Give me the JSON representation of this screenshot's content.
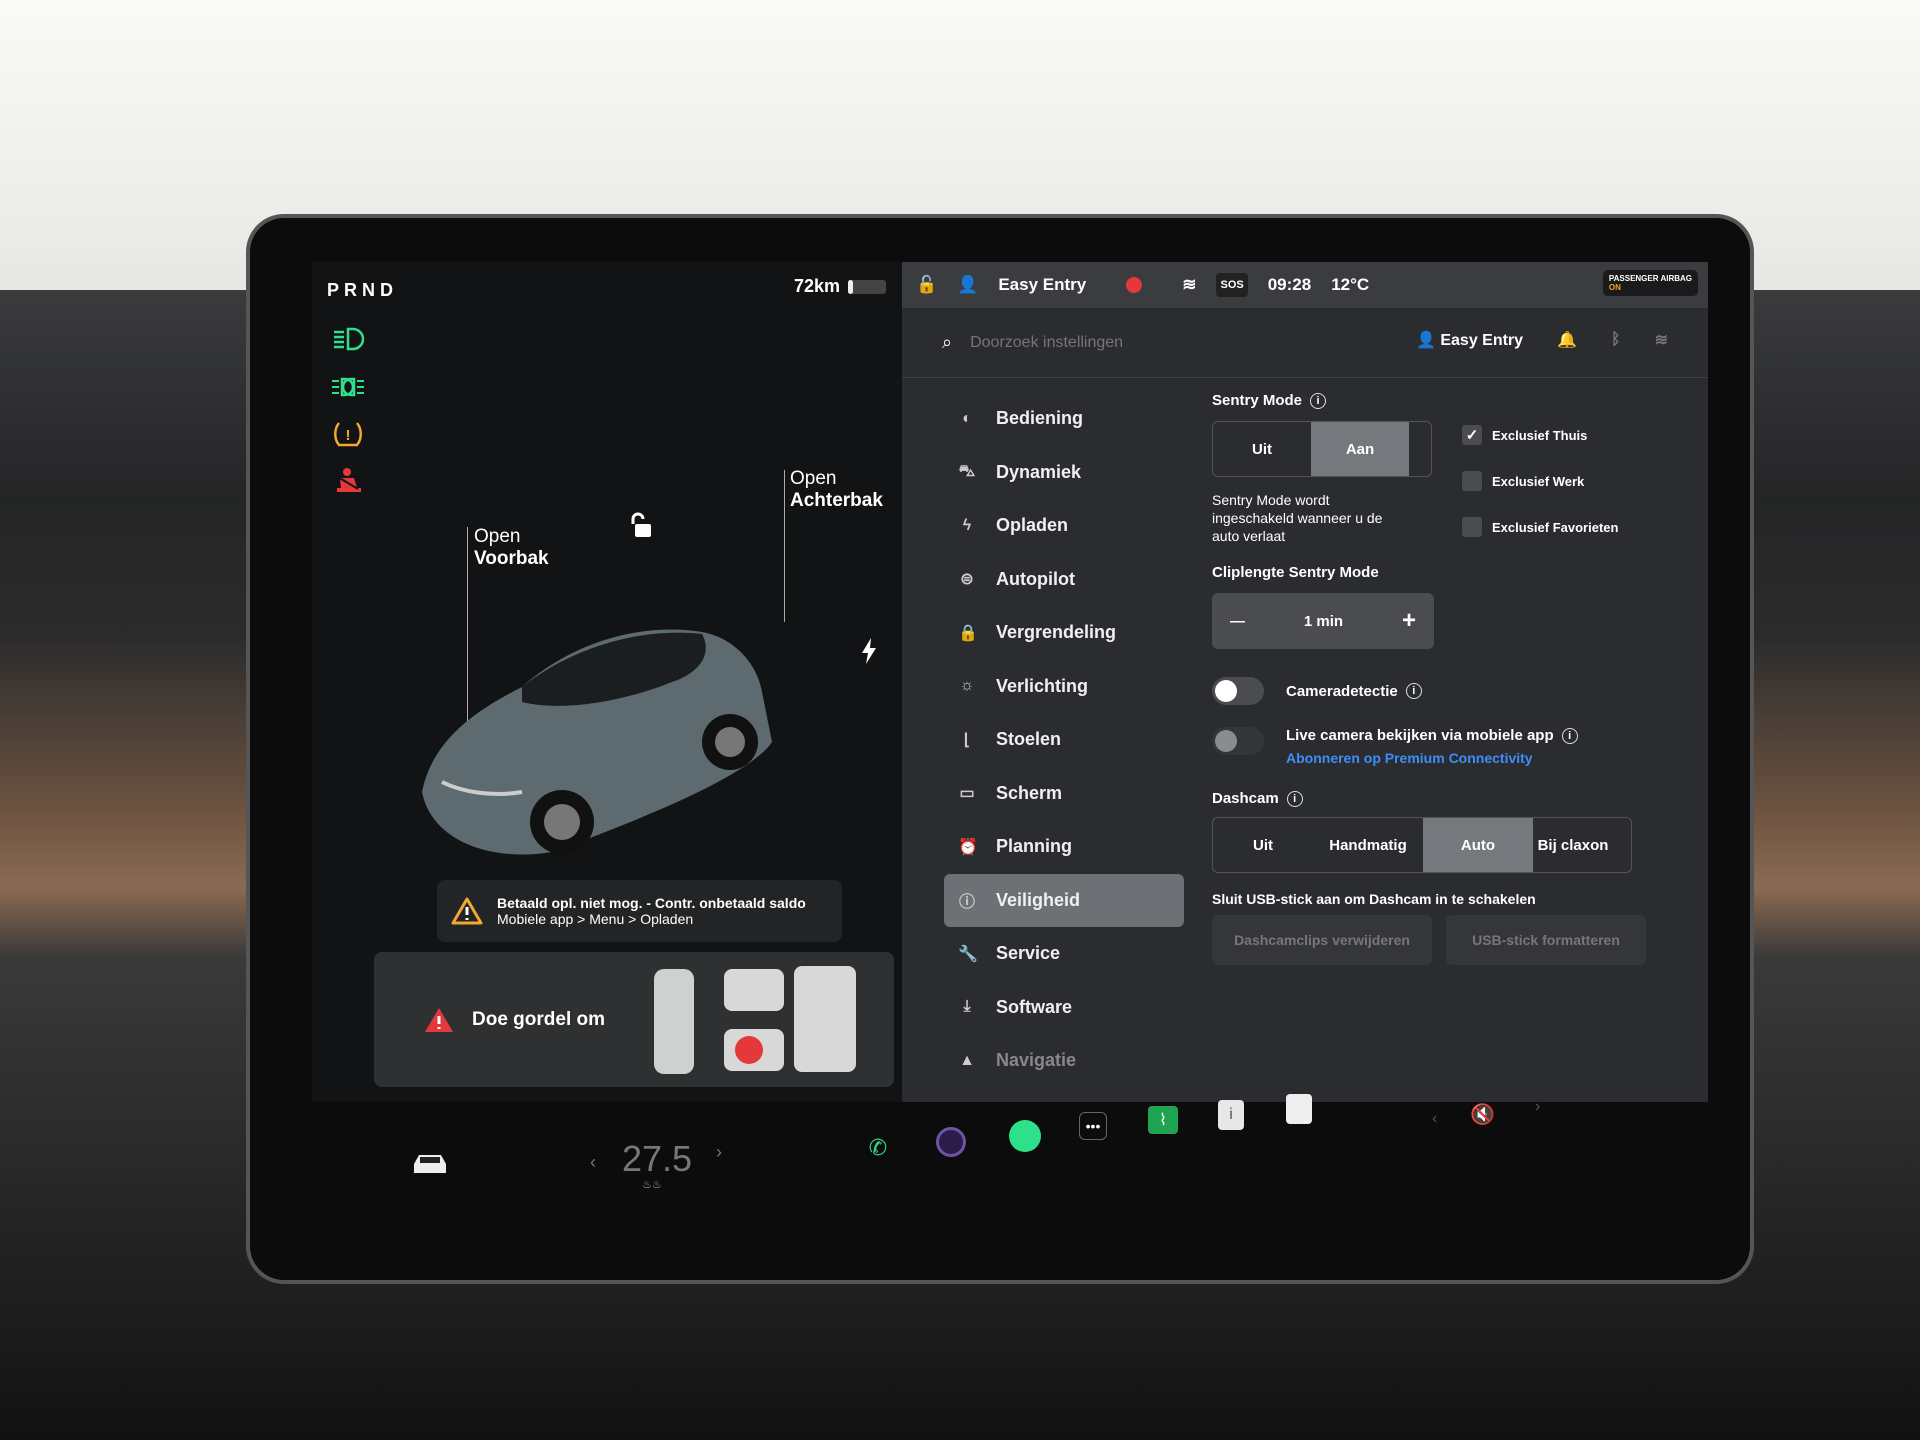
{
  "left_panel": {
    "gear": "PRND",
    "range": "72km",
    "battery_percent": 12,
    "telltales": [
      "low-beam-icon",
      "parking-lights-icon",
      "tire-pressure-warning-icon",
      "seatbelt-warning-icon"
    ],
    "frunk": {
      "line1": "Open",
      "line2": "Voorbak"
    },
    "trunk": {
      "line1": "Open",
      "line2": "Achterbak"
    },
    "charging_alert": {
      "title": "Betaald opl. niet mog. - Contr. onbetaald saldo",
      "subtitle": "Mobiele app > Menu > Opladen"
    },
    "belt_alert": "Doe gordel om"
  },
  "status_bar": {
    "profile": "Easy Entry",
    "time": "09:28",
    "temperature": "12°C",
    "sos": "SOS",
    "airbag_label": "PASSENGER AIRBAG",
    "airbag_state": "ON"
  },
  "search": {
    "placeholder": "Doorzoek instellingen",
    "profile": "Easy Entry"
  },
  "menu": [
    {
      "label": "Bediening",
      "icon": "toggle-icon"
    },
    {
      "label": "Dynamiek",
      "icon": "car-icon"
    },
    {
      "label": "Opladen",
      "icon": "bolt-icon"
    },
    {
      "label": "Autopilot",
      "icon": "steering-wheel-icon"
    },
    {
      "label": "Vergrendeling",
      "icon": "lock-icon"
    },
    {
      "label": "Verlichting",
      "icon": "sun-icon"
    },
    {
      "label": "Stoelen",
      "icon": "seat-icon"
    },
    {
      "label": "Scherm",
      "icon": "display-icon"
    },
    {
      "label": "Planning",
      "icon": "alarm-clock-icon"
    },
    {
      "label": "Veiligheid",
      "icon": "shield-info-icon",
      "active": true
    },
    {
      "label": "Service",
      "icon": "wrench-icon"
    },
    {
      "label": "Software",
      "icon": "download-icon"
    },
    {
      "label": "Navigatie",
      "icon": "navigation-icon"
    }
  ],
  "sentry": {
    "title": "Sentry Mode",
    "options": [
      "Uit",
      "Aan"
    ],
    "selected": "Aan",
    "description": "Sentry Mode wordt ingeschakeld wanneer u de auto verlaat",
    "exclusions": [
      {
        "label": "Exclusief Thuis",
        "checked": true
      },
      {
        "label": "Exclusief Werk",
        "checked": false
      },
      {
        "label": "Exclusief Favorieten",
        "checked": false
      }
    ],
    "clip_title": "Cliplengte Sentry Mode",
    "clip_value": "1 min",
    "minus": "—",
    "plus": "+"
  },
  "camera_detection": {
    "label": "Cameradetectie",
    "on": false
  },
  "live_camera": {
    "label": "Live camera bekijken via mobiele app",
    "link": "Abonneren op Premium Connectivity",
    "enabled": false
  },
  "dashcam": {
    "title": "Dashcam",
    "options": [
      "Uit",
      "Handmatig",
      "Auto",
      "Bij claxon"
    ],
    "selected": "Auto",
    "usb_notice": "Sluit USB-stick aan om Dashcam in te schakelen",
    "delete_button": "Dashcamclips verwijderen",
    "format_button": "USB-stick formatteren"
  },
  "dock": {
    "temperature": "27.5",
    "apps": [
      "phone-icon",
      "camera-icon",
      "spotify-icon",
      "more-icon",
      "stocks-icon",
      "manual-icon",
      "notes-icon"
    ],
    "volume": "muted"
  },
  "colors": {
    "accent_green": "#2ee08a",
    "warning_red": "#e5383b",
    "warning_amber": "#f0a830",
    "link_blue": "#3e8ef7"
  }
}
